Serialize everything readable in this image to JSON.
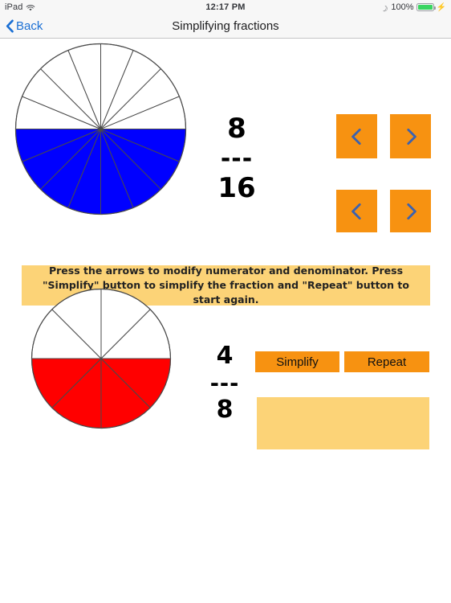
{
  "status_bar": {
    "device": "iPad",
    "wifi_icon": "wifi-icon",
    "time": "12:17 PM",
    "moon_icon": "crescent-moon-icon",
    "battery_percent": "100%",
    "battery_icon": "battery-full-icon",
    "charging_icon": "lightning-bolt-icon"
  },
  "nav": {
    "back_label": "Back",
    "back_icon": "chevron-left-icon",
    "title": "Simplifying fractions"
  },
  "colors": {
    "orange_button": "#f79211",
    "banner_background": "#fcd377",
    "chevron_blue": "#3b62b0",
    "top_pie_fill": "#0000ff",
    "bottom_pie_fill": "#ff0000",
    "back_blue": "#1a6fd4"
  },
  "top_fraction": {
    "numerator": "8",
    "denominator": "16",
    "divider": "---",
    "pie": {
      "total_segments": 16,
      "filled_segments": 8,
      "fill_color": "#0000ff",
      "stroke_color": "#4a4a4a"
    }
  },
  "bottom_fraction": {
    "numerator": "4",
    "denominator": "8",
    "divider": "---",
    "pie": {
      "total_segments": 8,
      "filled_segments": 4,
      "fill_color": "#ff0000",
      "stroke_color": "#4a4a4a"
    }
  },
  "arrow_buttons": [
    {
      "name": "numerator-decrease-button",
      "label": "<",
      "icon": "chevron-left-icon"
    },
    {
      "name": "numerator-increase-button",
      "label": ">",
      "icon": "chevron-right-icon"
    },
    {
      "name": "denominator-decrease-button",
      "label": "<",
      "icon": "chevron-left-icon"
    },
    {
      "name": "denominator-increase-button",
      "label": ">",
      "icon": "chevron-right-icon"
    }
  ],
  "instruction": {
    "text": "Press the arrows to modify numerator and denominator. Press \"Simplify\" button to simplify the fraction and \"Repeat\" button to start again."
  },
  "actions": {
    "simplify_label": "Simplify",
    "repeat_label": "Repeat"
  },
  "result": {
    "text": ""
  }
}
